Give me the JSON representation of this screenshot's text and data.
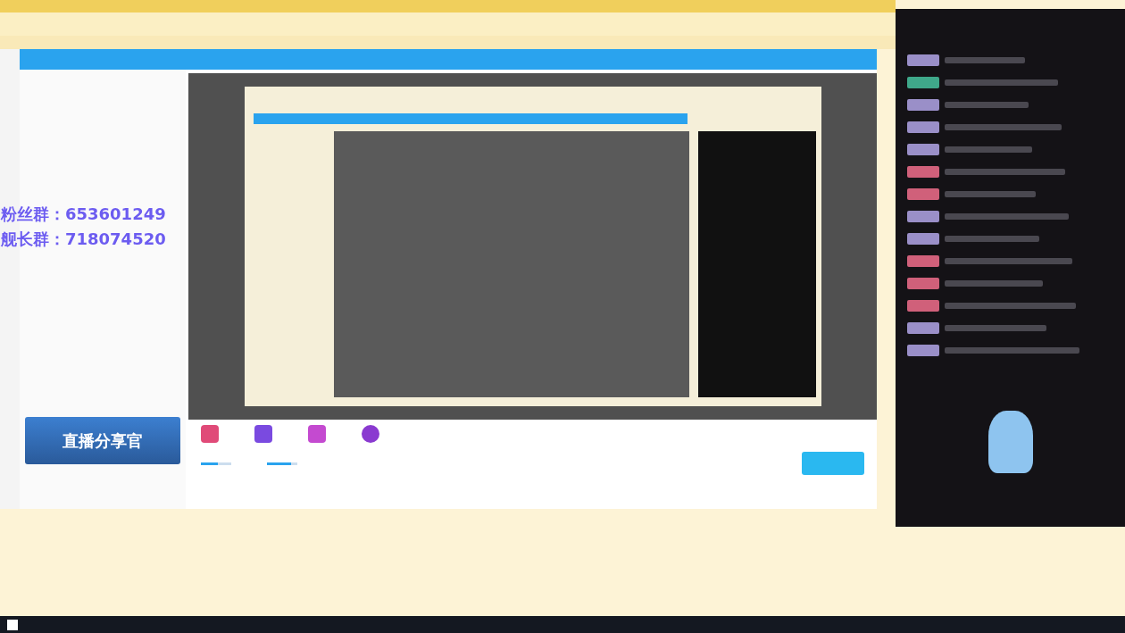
{
  "stream_overlay": {
    "lines": [
      "粉丝群：653601249",
      "舰长群：718074520"
    ]
  },
  "banner": {
    "title": "直播分享官"
  },
  "controls": {
    "sliders": [
      {
        "level": 0.55
      },
      {
        "level": 0.8
      }
    ]
  },
  "chat": {
    "messages": [
      {
        "color": "#9a8fc8"
      },
      {
        "color": "#3fa88a"
      },
      {
        "color": "#9a8fc8"
      },
      {
        "color": "#9a8fc8"
      },
      {
        "color": "#9a8fc8"
      },
      {
        "color": "#d0607a"
      },
      {
        "color": "#d0607a"
      },
      {
        "color": "#9a8fc8"
      },
      {
        "color": "#9a8fc8"
      },
      {
        "color": "#d0607a"
      },
      {
        "color": "#d0607a"
      },
      {
        "color": "#d0607a"
      },
      {
        "color": "#9a8fc8"
      },
      {
        "color": "#9a8fc8"
      }
    ]
  }
}
